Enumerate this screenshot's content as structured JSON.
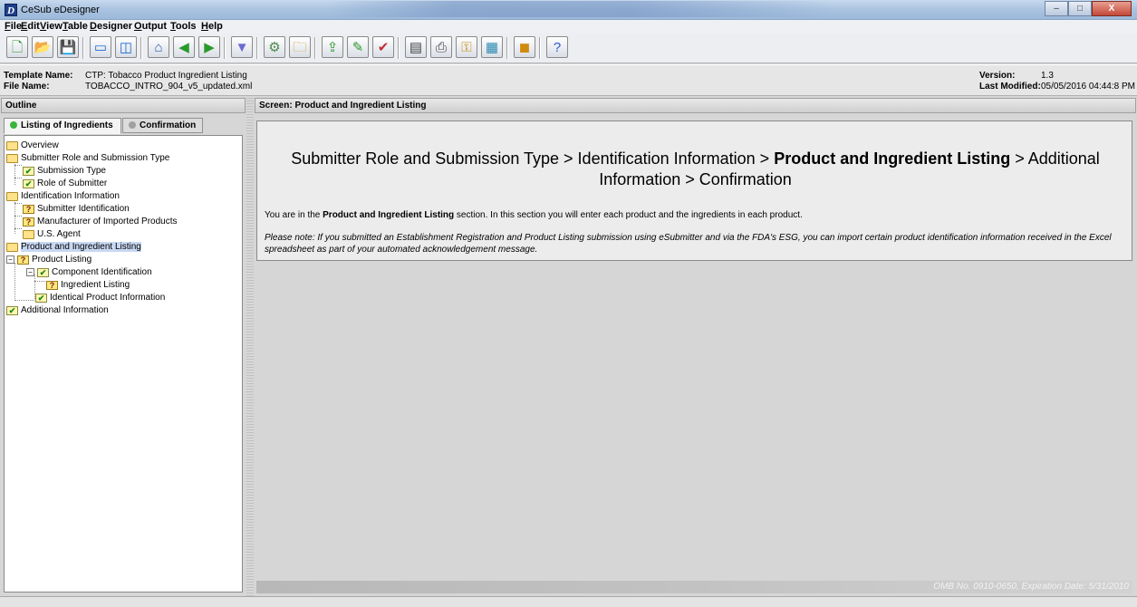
{
  "window": {
    "title": "CeSub eDesigner",
    "icon_letter": "D",
    "controls": {
      "minimize": "–",
      "maximize": "□",
      "close": "X"
    }
  },
  "menu": [
    {
      "label": "File"
    },
    {
      "label": "Edit"
    },
    {
      "label": "View"
    },
    {
      "label": "Table"
    },
    {
      "label": "Designer"
    },
    {
      "label": "Output"
    },
    {
      "label": "Tools"
    },
    {
      "label": "Help"
    }
  ],
  "toolbar": {
    "buttons": [
      {
        "name": "new-document-icon",
        "glyph": "🗋",
        "color": "#2a8a2a"
      },
      {
        "name": "open-folder-icon",
        "glyph": "📂",
        "color": "#c89a10"
      },
      {
        "name": "save-icon",
        "glyph": "💾",
        "color": "#1e4fa0"
      },
      {
        "name": "window-icon",
        "glyph": "▭",
        "color": "#1e6ad0"
      },
      {
        "name": "split-window-icon",
        "glyph": "◫",
        "color": "#1e6ad0"
      },
      {
        "name": "home-icon",
        "glyph": "⌂",
        "color": "#2a5ab0"
      },
      {
        "name": "back-arrow-icon",
        "glyph": "◀",
        "color": "#2a9a2a"
      },
      {
        "name": "forward-arrow-icon",
        "glyph": "▶",
        "color": "#2a9a2a"
      },
      {
        "name": "filter-icon",
        "glyph": "▼",
        "color": "#6a6ad0"
      },
      {
        "name": "settings-icon",
        "glyph": "⚙",
        "color": "#4a8a4a"
      },
      {
        "name": "folder-tree-icon",
        "glyph": "🗀",
        "color": "#d09a10"
      },
      {
        "name": "export-icon",
        "glyph": "⇪",
        "color": "#2a9a2a"
      },
      {
        "name": "edit-icon",
        "glyph": "✎",
        "color": "#2a9a2a"
      },
      {
        "name": "validate-icon",
        "glyph": "✔",
        "color": "#c03030"
      },
      {
        "name": "document-icon",
        "glyph": "▤",
        "color": "#444444"
      },
      {
        "name": "print-icon",
        "glyph": "⎙",
        "color": "#444444"
      },
      {
        "name": "key-icon",
        "glyph": "⚿",
        "color": "#c88a10"
      },
      {
        "name": "calculator-icon",
        "glyph": "▦",
        "color": "#2a8ab0"
      },
      {
        "name": "package-icon",
        "glyph": "◼",
        "color": "#d08a10"
      },
      {
        "name": "help-icon",
        "glyph": "?",
        "color": "#2a5ad0"
      }
    ]
  },
  "info": {
    "template_label": "Template Name:",
    "template_value": "CTP: Tobacco Product Ingredient Listing",
    "file_label": "File Name:",
    "file_value": "TOBACCO_INTRO_904_v5_updated.xml",
    "version_label": "Version:",
    "version_value": "1.3",
    "modified_label": "Last Modified:",
    "modified_value": "05/05/2016 04:44:8 PM"
  },
  "outline": {
    "header": "Outline",
    "tabs": [
      {
        "label": "Listing of Ingredients",
        "dot_color": "#3cb43c"
      },
      {
        "label": "Confirmation",
        "dot_color": "#a0a0a0"
      }
    ],
    "tree": [
      {
        "label": "Overview",
        "icon": "folder"
      },
      {
        "label": "Submitter Role and Submission Type",
        "icon": "folder"
      },
      {
        "label": "Submission Type",
        "icon": "check"
      },
      {
        "label": "Role of Submitter",
        "icon": "check"
      },
      {
        "label": "Identification Information",
        "icon": "folder"
      },
      {
        "label": "Submitter Identification",
        "icon": "question"
      },
      {
        "label": "Manufacturer of Imported Products",
        "icon": "question"
      },
      {
        "label": "U.S. Agent",
        "icon": "folder"
      },
      {
        "label": "Product and Ingredient Listing",
        "icon": "folder"
      },
      {
        "label": "Product Listing",
        "icon": "question"
      },
      {
        "label": "Component Identification",
        "icon": "check"
      },
      {
        "label": "Ingredient Listing",
        "icon": "question"
      },
      {
        "label": "Identical Product Information",
        "icon": "check"
      },
      {
        "label": "Additional Information",
        "icon": "check"
      }
    ]
  },
  "screen": {
    "header": "Screen: Product and Ingredient Listing",
    "crumb_1": "Submitter Role and Submission Type > Identification Information > ",
    "crumb_bold": "Product and Ingredient Listing",
    "crumb_2": " > Additional",
    "crumb_3": "Information > Confirmation",
    "intro_1": "You are in the ",
    "intro_bold": "Product and Ingredient Listing",
    "intro_2": " section. In this section you will enter each product and the ingredients in each product.",
    "note": "Please note: If you submitted an Establishment Registration and Product Listing submission using eSubmitter and via the FDA's ESG, you can import certain product identification information received in the Excel spreadsheet as part of your automated acknowledgement message.",
    "omb": "OMB No. 0910-0650, Expiration Date: 5/31/2010"
  }
}
